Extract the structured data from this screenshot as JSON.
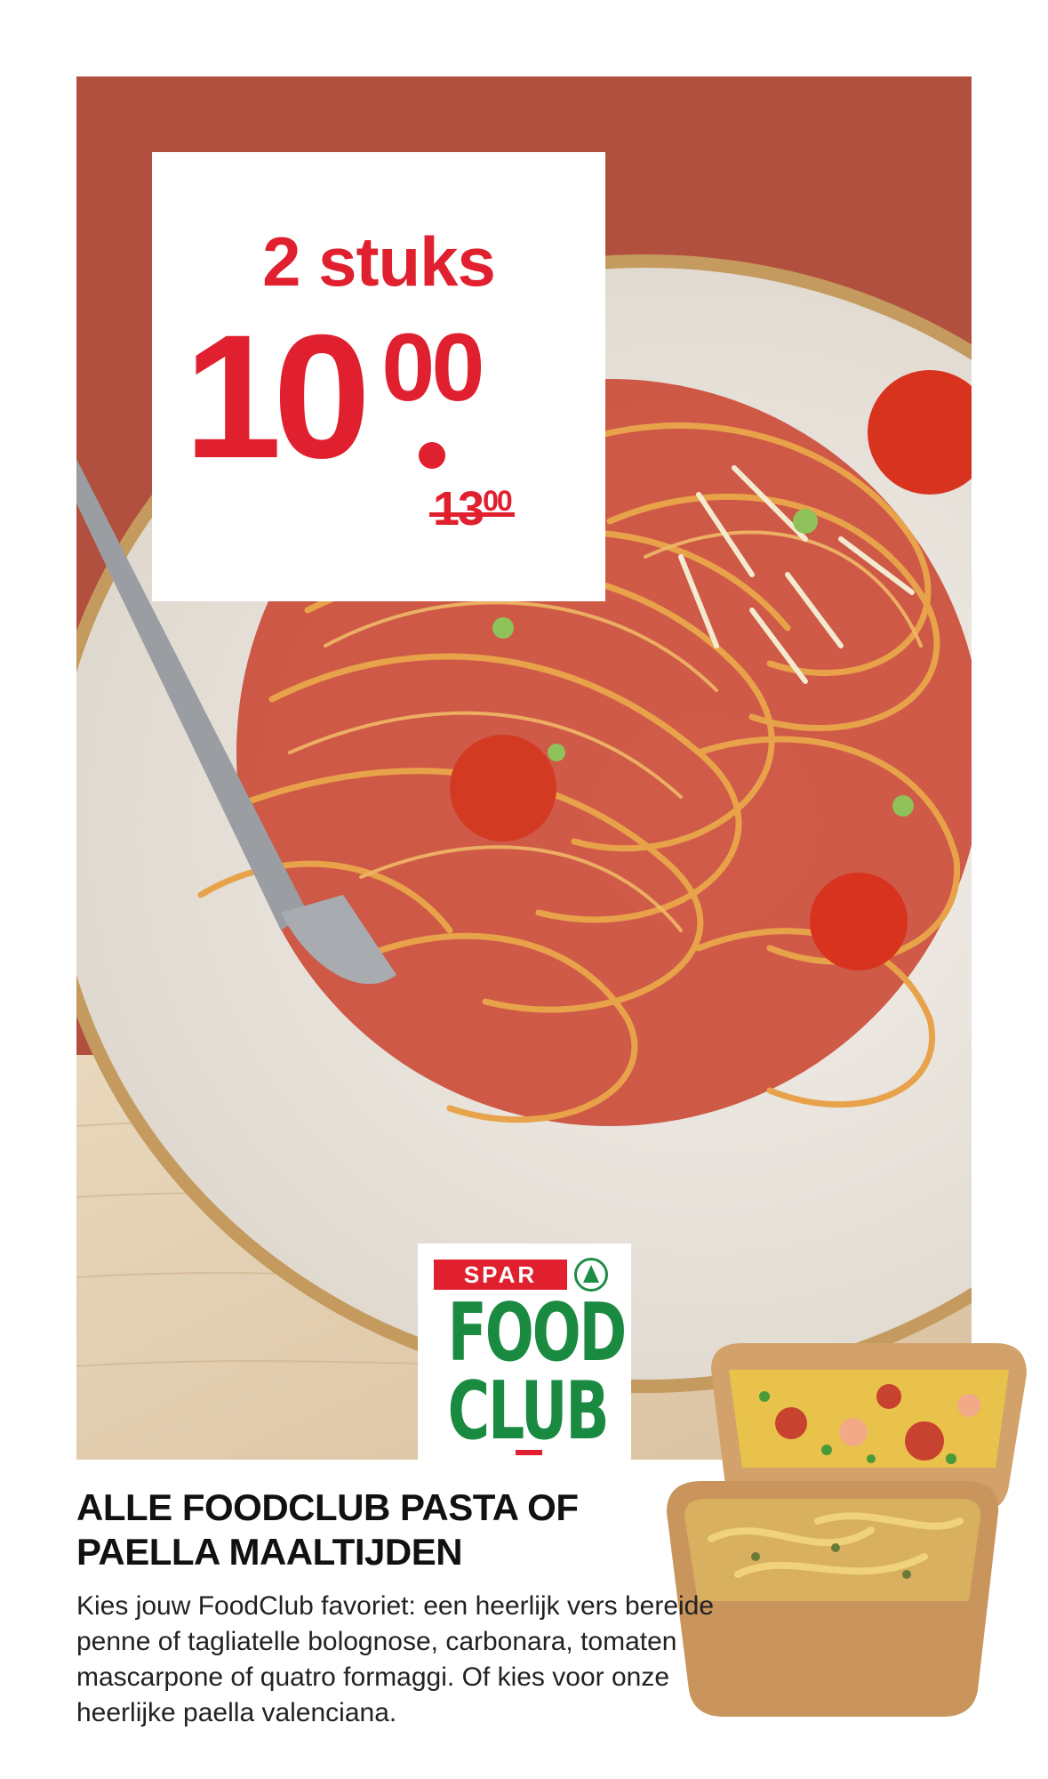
{
  "offer": {
    "quantity_label": "2 stuks",
    "price_main": "10",
    "price_cents": "00",
    "old_price_main": "13",
    "old_price_cents": "00"
  },
  "logo": {
    "spar_label": "SPAR",
    "line1": "FOOD",
    "line2": "CLUB"
  },
  "product": {
    "title": "ALLE FOODCLUB PASTA OF PAELLA MAALTIJDEN",
    "description": "Kies jouw FoodClub favoriet: een heerlijk vers bereide penne of tagliatelle bolognose, carbonara, tomaten mascarpone of quatro formaggi. Of kies voor onze heerlijke paella valenciana."
  },
  "colors": {
    "brand_red": "#e0202e",
    "brand_green": "#1a8a41",
    "background_terracotta": "#b2503f"
  }
}
